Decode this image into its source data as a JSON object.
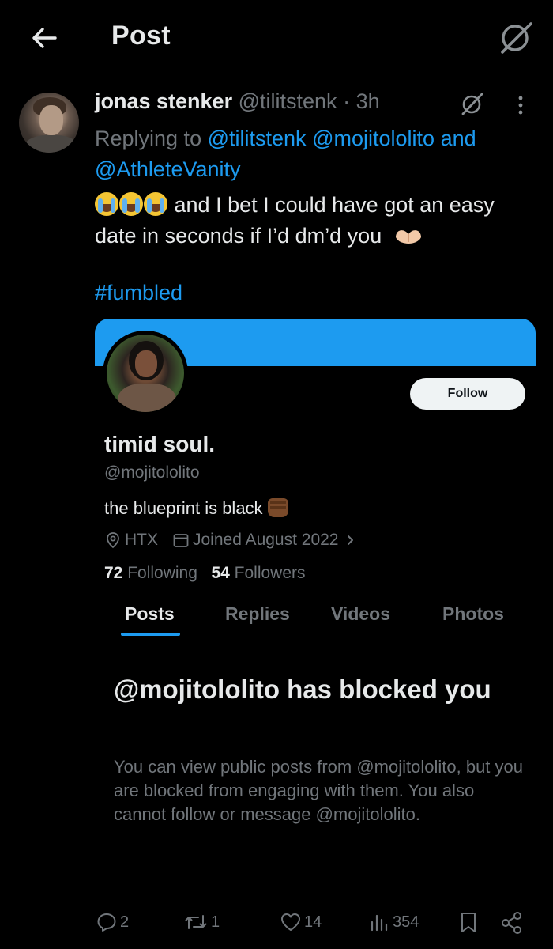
{
  "header": {
    "title": "Post"
  },
  "tweet": {
    "name": "jonas stenker",
    "handle": "@tilitstenk",
    "dot": "·",
    "time": "3h",
    "replying_prefix": "Replying to",
    "mention_1": "@tilitstenk",
    "mention_2": "@mojitololito",
    "and": "and",
    "mention_3": "@AthleteVanity",
    "body": "and I bet I could have got an easy date in seconds if I’d dm’d you",
    "hashtag": "#fumbled"
  },
  "profile": {
    "follow_label": "Follow",
    "name": "timid soul.",
    "handle": "@mojitololito",
    "bio": "the blueprint is black",
    "location": "HTX",
    "joined": "Joined August 2022",
    "following_count": "72",
    "following_label": "Following",
    "followers_count": "54",
    "followers_label": "Followers",
    "tabs": [
      "Posts",
      "Replies",
      "Videos",
      "Photos"
    ],
    "active_tab": "Posts",
    "blocked_title": "@mojitololito has blocked you",
    "blocked_desc": "You can view public posts from @mojitololito, but you are blocked from engaging with them. You also cannot follow or message @mojitololito."
  },
  "actions": {
    "replies": "2",
    "reposts": "1",
    "likes": "14",
    "views": "354"
  },
  "colors": {
    "accent": "#1d9bf0",
    "muted": "#71767b",
    "text": "#e7e9ea",
    "bg": "#000000"
  }
}
